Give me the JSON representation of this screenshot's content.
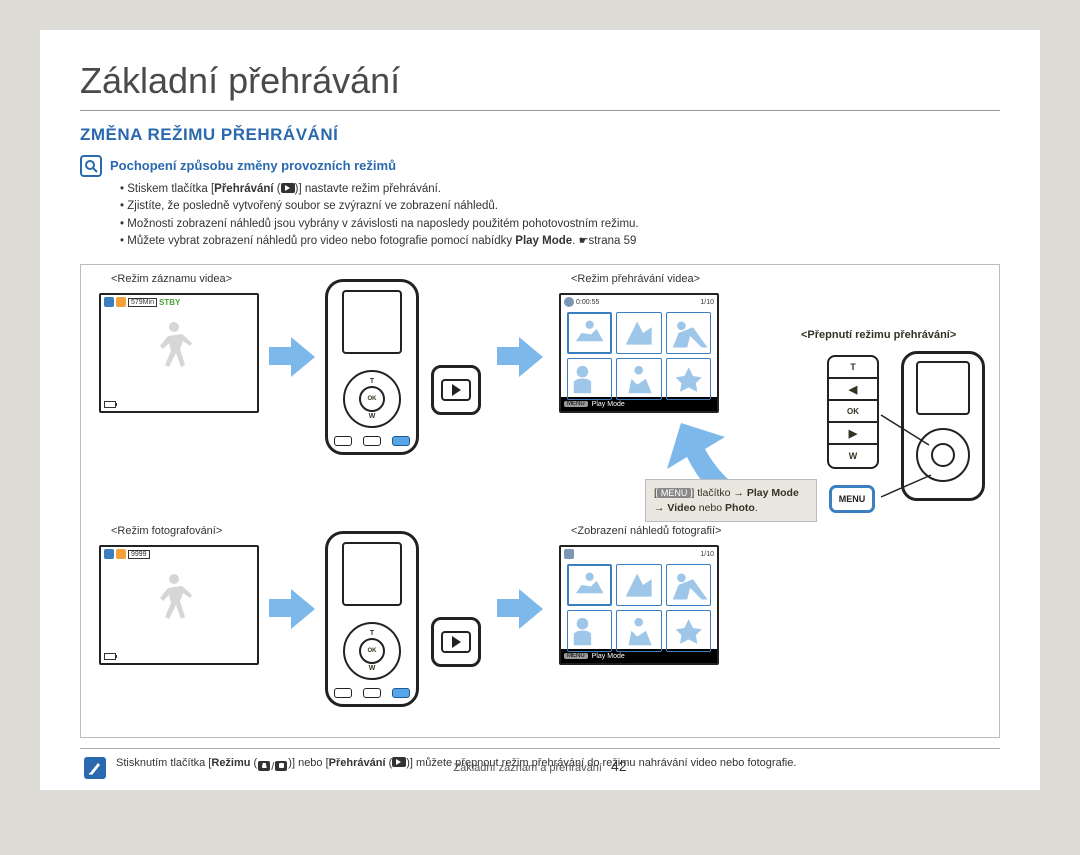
{
  "page_title": "Základní přehrávání",
  "section_heading": "ZMĚNA REŽIMU PŘEHRÁVÁNÍ",
  "sub_heading": "Pochopení způsobu změny provozních režimů",
  "bullets": {
    "b1_a": "Stiskem tlačítka [",
    "b1_b": "Přehrávání",
    "b1_c": " (",
    "b1_d": ")] nastavte režim přehrávání.",
    "b2": "Zjistíte, že posledně vytvořený soubor se zvýrazní ve zobrazení náhledů.",
    "b3": "Možnosti zobrazení náhledů jsou vybrány v závislosti na naposledy použitém pohotovostním režimu.",
    "b4_a": "Můžete vybrat zobrazení náhledů pro video nebo fotografie pomocí nabídky ",
    "b4_b": "Play Mode",
    "b4_c": ". ",
    "b4_d": "strana 59"
  },
  "labels": {
    "video_rec": "<Režim záznamu videa>",
    "video_play": "<Režim přehrávání videa>",
    "photo_rec": "<Režim fotografování>",
    "photo_thumb": "<Zobrazení náhledů fotografií>",
    "switch": "<Přepnutí režimu přehrávání>"
  },
  "lcd": {
    "video_time": "579Min",
    "stby": "STBY",
    "photo_count": "9999",
    "play_time": "0:00:55",
    "counter": "1/10",
    "menu": "MENU",
    "playmode": "Play Mode"
  },
  "dpad": {
    "t": "T",
    "w": "W",
    "ok": "OK"
  },
  "menu_btn": "MENU",
  "tip": {
    "a": "[",
    "b": "] tlačítko → ",
    "c": "Play Mode",
    "d": " → ",
    "e": "Video",
    "f": " nebo ",
    "g": "Photo",
    "h": "."
  },
  "footer_note": {
    "a": "Stisknutím tlačítka [",
    "b": "Režimu",
    "c": " (",
    "d": ")] nebo [",
    "e": "Přehrávání",
    "f": " (",
    "g": ")] můžete přepnout režim přehrávání do režimu nahrávání video nebo fotografie."
  },
  "page_footer": {
    "text": "Základní záznam a přehrávání",
    "num": "42"
  }
}
